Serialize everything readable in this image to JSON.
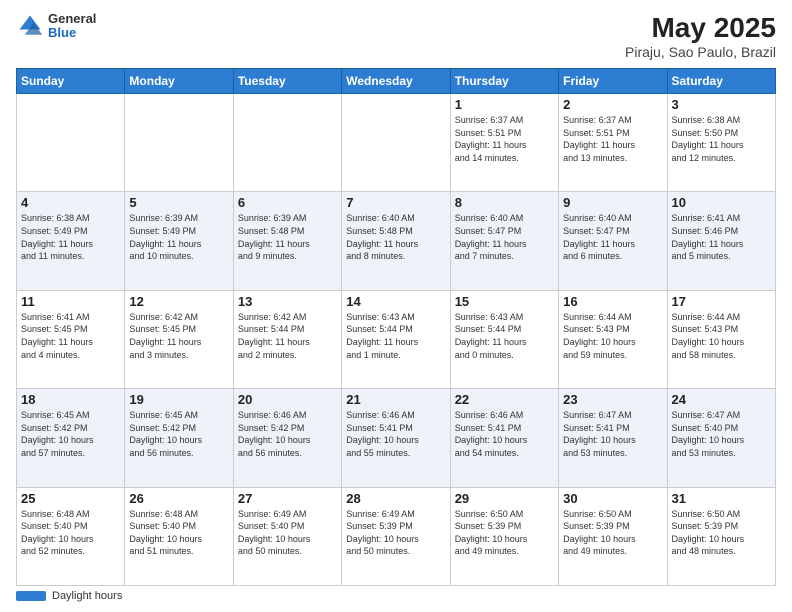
{
  "header": {
    "logo_general": "General",
    "logo_blue": "Blue",
    "title": "May 2025",
    "subtitle": "Piraju, Sao Paulo, Brazil"
  },
  "weekdays": [
    "Sunday",
    "Monday",
    "Tuesday",
    "Wednesday",
    "Thursday",
    "Friday",
    "Saturday"
  ],
  "weeks": [
    [
      {
        "num": "",
        "info": ""
      },
      {
        "num": "",
        "info": ""
      },
      {
        "num": "",
        "info": ""
      },
      {
        "num": "",
        "info": ""
      },
      {
        "num": "1",
        "info": "Sunrise: 6:37 AM\nSunset: 5:51 PM\nDaylight: 11 hours\nand 14 minutes."
      },
      {
        "num": "2",
        "info": "Sunrise: 6:37 AM\nSunset: 5:51 PM\nDaylight: 11 hours\nand 13 minutes."
      },
      {
        "num": "3",
        "info": "Sunrise: 6:38 AM\nSunset: 5:50 PM\nDaylight: 11 hours\nand 12 minutes."
      }
    ],
    [
      {
        "num": "4",
        "info": "Sunrise: 6:38 AM\nSunset: 5:49 PM\nDaylight: 11 hours\nand 11 minutes."
      },
      {
        "num": "5",
        "info": "Sunrise: 6:39 AM\nSunset: 5:49 PM\nDaylight: 11 hours\nand 10 minutes."
      },
      {
        "num": "6",
        "info": "Sunrise: 6:39 AM\nSunset: 5:48 PM\nDaylight: 11 hours\nand 9 minutes."
      },
      {
        "num": "7",
        "info": "Sunrise: 6:40 AM\nSunset: 5:48 PM\nDaylight: 11 hours\nand 8 minutes."
      },
      {
        "num": "8",
        "info": "Sunrise: 6:40 AM\nSunset: 5:47 PM\nDaylight: 11 hours\nand 7 minutes."
      },
      {
        "num": "9",
        "info": "Sunrise: 6:40 AM\nSunset: 5:47 PM\nDaylight: 11 hours\nand 6 minutes."
      },
      {
        "num": "10",
        "info": "Sunrise: 6:41 AM\nSunset: 5:46 PM\nDaylight: 11 hours\nand 5 minutes."
      }
    ],
    [
      {
        "num": "11",
        "info": "Sunrise: 6:41 AM\nSunset: 5:45 PM\nDaylight: 11 hours\nand 4 minutes."
      },
      {
        "num": "12",
        "info": "Sunrise: 6:42 AM\nSunset: 5:45 PM\nDaylight: 11 hours\nand 3 minutes."
      },
      {
        "num": "13",
        "info": "Sunrise: 6:42 AM\nSunset: 5:44 PM\nDaylight: 11 hours\nand 2 minutes."
      },
      {
        "num": "14",
        "info": "Sunrise: 6:43 AM\nSunset: 5:44 PM\nDaylight: 11 hours\nand 1 minute."
      },
      {
        "num": "15",
        "info": "Sunrise: 6:43 AM\nSunset: 5:44 PM\nDaylight: 11 hours\nand 0 minutes."
      },
      {
        "num": "16",
        "info": "Sunrise: 6:44 AM\nSunset: 5:43 PM\nDaylight: 10 hours\nand 59 minutes."
      },
      {
        "num": "17",
        "info": "Sunrise: 6:44 AM\nSunset: 5:43 PM\nDaylight: 10 hours\nand 58 minutes."
      }
    ],
    [
      {
        "num": "18",
        "info": "Sunrise: 6:45 AM\nSunset: 5:42 PM\nDaylight: 10 hours\nand 57 minutes."
      },
      {
        "num": "19",
        "info": "Sunrise: 6:45 AM\nSunset: 5:42 PM\nDaylight: 10 hours\nand 56 minutes."
      },
      {
        "num": "20",
        "info": "Sunrise: 6:46 AM\nSunset: 5:42 PM\nDaylight: 10 hours\nand 56 minutes."
      },
      {
        "num": "21",
        "info": "Sunrise: 6:46 AM\nSunset: 5:41 PM\nDaylight: 10 hours\nand 55 minutes."
      },
      {
        "num": "22",
        "info": "Sunrise: 6:46 AM\nSunset: 5:41 PM\nDaylight: 10 hours\nand 54 minutes."
      },
      {
        "num": "23",
        "info": "Sunrise: 6:47 AM\nSunset: 5:41 PM\nDaylight: 10 hours\nand 53 minutes."
      },
      {
        "num": "24",
        "info": "Sunrise: 6:47 AM\nSunset: 5:40 PM\nDaylight: 10 hours\nand 53 minutes."
      }
    ],
    [
      {
        "num": "25",
        "info": "Sunrise: 6:48 AM\nSunset: 5:40 PM\nDaylight: 10 hours\nand 52 minutes."
      },
      {
        "num": "26",
        "info": "Sunrise: 6:48 AM\nSunset: 5:40 PM\nDaylight: 10 hours\nand 51 minutes."
      },
      {
        "num": "27",
        "info": "Sunrise: 6:49 AM\nSunset: 5:40 PM\nDaylight: 10 hours\nand 50 minutes."
      },
      {
        "num": "28",
        "info": "Sunrise: 6:49 AM\nSunset: 5:39 PM\nDaylight: 10 hours\nand 50 minutes."
      },
      {
        "num": "29",
        "info": "Sunrise: 6:50 AM\nSunset: 5:39 PM\nDaylight: 10 hours\nand 49 minutes."
      },
      {
        "num": "30",
        "info": "Sunrise: 6:50 AM\nSunset: 5:39 PM\nDaylight: 10 hours\nand 49 minutes."
      },
      {
        "num": "31",
        "info": "Sunrise: 6:50 AM\nSunset: 5:39 PM\nDaylight: 10 hours\nand 48 minutes."
      }
    ]
  ],
  "footer": {
    "bar_label": "Daylight hours"
  }
}
